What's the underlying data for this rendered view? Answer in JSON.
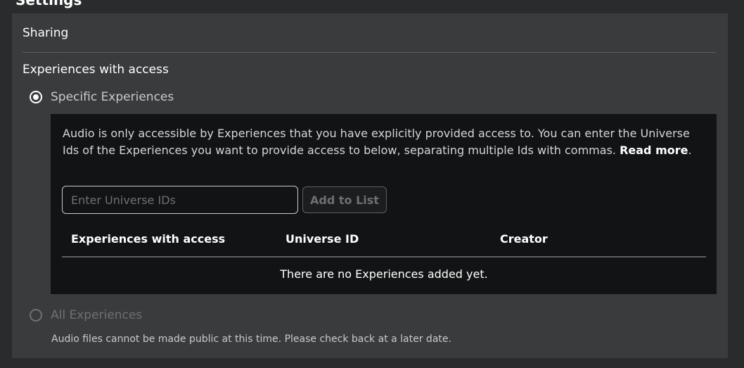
{
  "page": {
    "cut_title": "Settings"
  },
  "sharing": {
    "title": "Sharing",
    "experiences_title": "Experiences with access",
    "options": {
      "specific": {
        "label": "Specific Experiences",
        "selected": true
      },
      "all": {
        "label": "All Experiences",
        "selected": false,
        "disabled": true
      }
    },
    "specific_panel": {
      "description": "Audio is only accessible by Experiences that you have explicitly provided access to. You can enter the Universe Ids of the Experiences you want to provide access to below, separating multiple Ids with commas. ",
      "read_more": "Read more",
      "read_more_suffix": ".",
      "input": {
        "placeholder": "Enter Universe IDs",
        "value": ""
      },
      "add_button": "Add to List",
      "table": {
        "columns": [
          "Experiences with access",
          "Universe ID",
          "Creator"
        ],
        "rows": [],
        "empty_message": "There are no Experiences added yet."
      }
    },
    "all_note": "Audio files cannot be made public at this time. Please check back at a later date."
  },
  "colors": {
    "background": "#2a2b2c",
    "panel": "#393b3d",
    "inner_panel": "#121314",
    "divider": "#5c5e61",
    "disabled_text": "#6e7073"
  }
}
